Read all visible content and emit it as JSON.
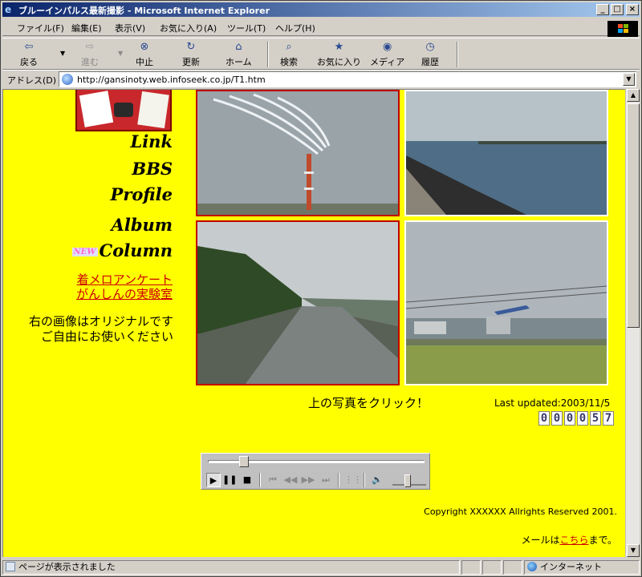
{
  "window": {
    "title": "ブルーインパルス最新撮影 - Microsoft Internet Explorer",
    "buttons": {
      "minimize": "_",
      "maximize": "□",
      "close": "×"
    }
  },
  "menu": [
    "ファイル(F)",
    "編集(E)",
    "表示(V)",
    "お気に入り(A)",
    "ツール(T)",
    "ヘルプ(H)"
  ],
  "toolbar": {
    "back": "戻る",
    "forward": "進む",
    "stop": "中止",
    "refresh": "更新",
    "home": "ホーム",
    "search": "検索",
    "favorites": "お気に入り",
    "media": "メディア",
    "history": "履歴"
  },
  "address": {
    "label": "アドレス(D)",
    "url": "http://gansinoty.web.infoseek.co.jp/T1.htm"
  },
  "sidebar": {
    "links": [
      "Link",
      "BBS",
      "Profile",
      "Album",
      "Column"
    ],
    "new_badge": "NEW",
    "red_links": [
      "着メロアンケート",
      "がんしんの実験室"
    ],
    "note_line1": "右の画像はオリジナルです",
    "note_line2": "ご自由にお使いください"
  },
  "main": {
    "click_hint": "上の写真をクリック！",
    "updated_label": "Last updated:2003/11/5",
    "counter_digits": [
      "0",
      "0",
      "0",
      "0",
      "5",
      "7"
    ]
  },
  "player": {
    "play": "▶",
    "pause": "❚❚",
    "stop": "■",
    "prev": "⏮",
    "rewind": "◀◀",
    "ffwd": "▶▶",
    "next": "⏭",
    "playlist": "⋮⋮",
    "volume": "🔈",
    "seek_fraction": 0.15,
    "volume_fraction": 0.45
  },
  "footer": {
    "copyright": "Copyright XXXXXX Allrights Reserved 2001.",
    "mail_prefix": "メールは",
    "mail_link": "こちら",
    "mail_suffix": "まで。"
  },
  "status": {
    "text": "ページが表示されました",
    "zone": "インターネット"
  },
  "colors": {
    "page_bg": "#ffff00",
    "link_red": "#cc0000",
    "title_gradient_start": "#0a246a"
  }
}
